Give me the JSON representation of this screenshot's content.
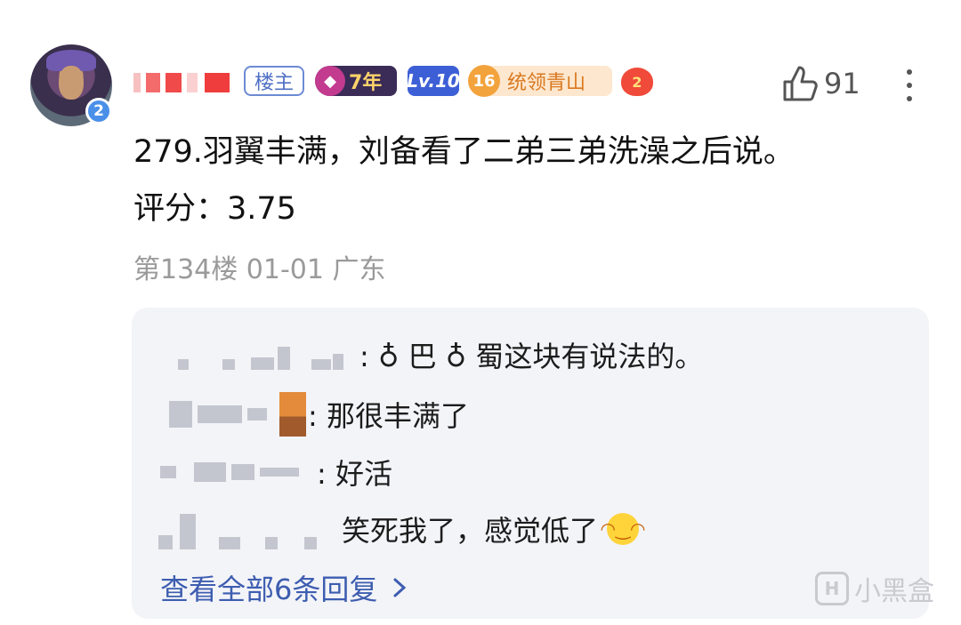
{
  "post": {
    "author_badge_level": "2",
    "tags": {
      "owner": "楼主",
      "years": "7年",
      "level": "Lv.10",
      "title_level": "16",
      "title": "统领青山",
      "medal": "2"
    },
    "like_count": "91",
    "content_line1": "279.羽翼丰满，刘备看了二弟三弟洗澡之后说。",
    "content_line2": "评分：3.75",
    "meta": "第134楼 01-01 广东"
  },
  "replies": [
    {
      "text": ": ♁ 巴 ♁ 蜀这块有说法的。"
    },
    {
      "text": ": 那很丰满了"
    },
    {
      "text": ": 好活"
    },
    {
      "text": "笑死我了，感觉低了"
    }
  ],
  "view_all": "查看全部6条回复",
  "watermark": "小黑盒",
  "colors": {
    "link": "#3d5db0",
    "meta": "#9a9a9a",
    "reply_bg": "#f3f4f8"
  }
}
